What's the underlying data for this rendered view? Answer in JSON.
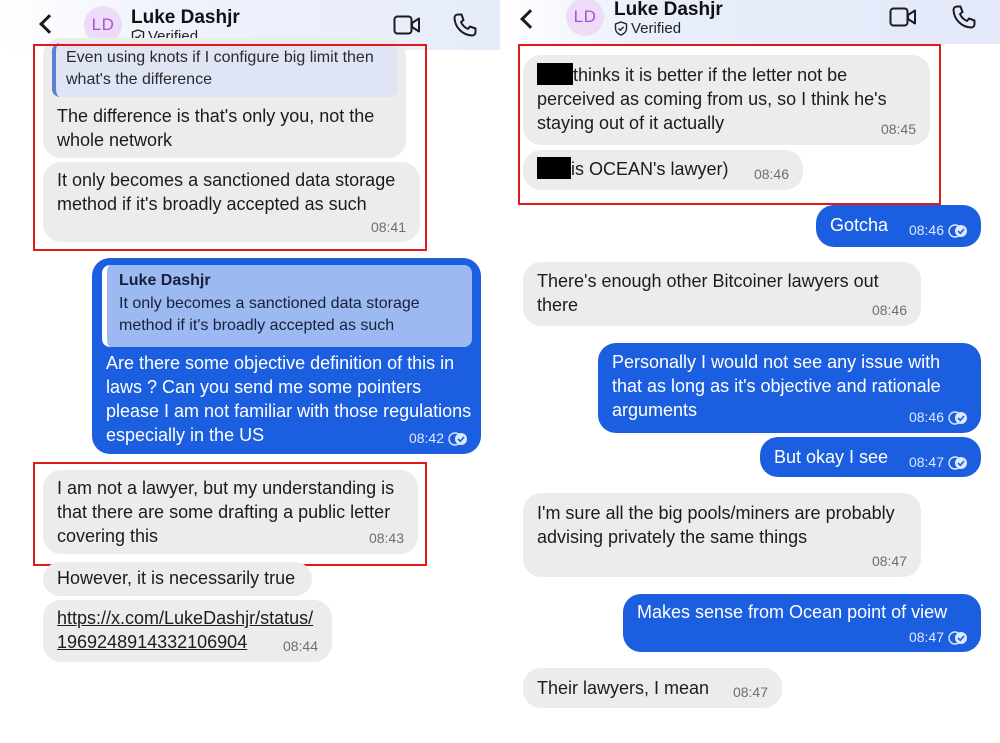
{
  "left": {
    "contact": {
      "initials": "LD",
      "name": "Luke Dashjr",
      "verified": "Verified"
    },
    "messages": [
      {
        "quote_text": "Even using knots if I configure big limit then what's the difference",
        "text": "The difference is that's only you, not the whole network"
      },
      {
        "text": "It only becomes a sanctioned data storage method if it's broadly accepted as such",
        "time": "08:41"
      },
      {
        "quote_author": "Luke Dashjr",
        "quote_text": "It only becomes a sanctioned data storage method if it's broadly accepted as such",
        "text": "Are there some objective definition of this in laws ? Can you send me some pointers please I am not familiar with those regulations especially in the US",
        "time": "08:42"
      },
      {
        "text": "I am not a lawyer, but my understanding is that there are some drafting a public letter covering this",
        "time": "08:43"
      },
      {
        "text": "However, it is necessarily true"
      },
      {
        "link_line1": "https://x.com/LukeDashjr/status/",
        "link_line2": "1969248914332106904",
        "time": "08:44"
      }
    ]
  },
  "right": {
    "contact": {
      "initials": "LD",
      "name": "Luke Dashjr",
      "verified": "Verified"
    },
    "messages": [
      {
        "text": "thinks it is better if the letter not be perceived as coming from us, so I think he's staying out of it actually",
        "time": "08:45"
      },
      {
        "text": "is OCEAN's lawyer)",
        "time": "08:46"
      },
      {
        "text": "Gotcha",
        "time": "08:46"
      },
      {
        "text": "There's enough other Bitcoiner lawyers out there",
        "time": "08:46"
      },
      {
        "text": "Personally I would not see any issue with that as long as it's objective and rationale arguments",
        "time": "08:46"
      },
      {
        "text": "But okay I see",
        "time": "08:47"
      },
      {
        "text": "I'm sure all the big pools/miners are probably advising privately the same things",
        "time": "08:47"
      },
      {
        "text": "Makes sense from Ocean point of view",
        "time": "08:47"
      },
      {
        "text": "Their lawyers, I mean",
        "time": "08:47"
      }
    ]
  },
  "colors": {
    "incoming": "#ececed",
    "outgoing": "#1b5fe0",
    "highlight_box": "#e0191b",
    "avatar_bg": "#ecdcf7",
    "avatar_text": "#b34cd0"
  }
}
